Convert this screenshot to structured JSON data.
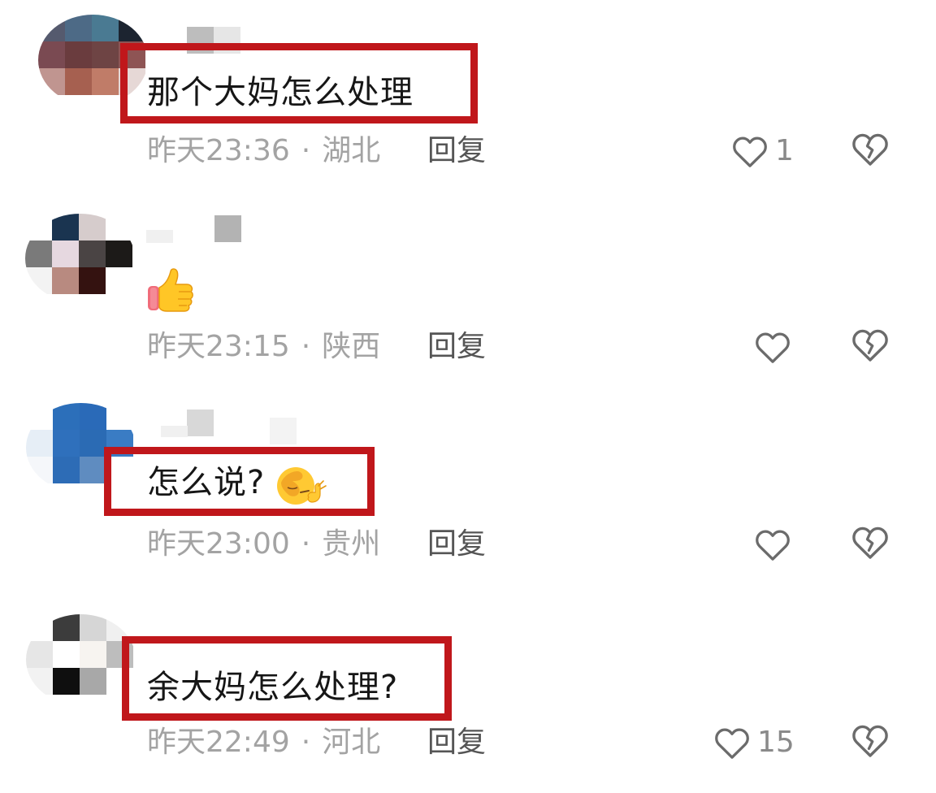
{
  "comments": [
    {
      "text": "那个大妈怎么处理",
      "time": "昨天23:36",
      "separator": "·",
      "location": "湖北",
      "reply_label": "回复",
      "likes": "1",
      "highlighted": true,
      "emoji": ""
    },
    {
      "text": "",
      "time": "昨天23:15",
      "separator": "·",
      "location": "陕西",
      "reply_label": "回复",
      "likes": "",
      "highlighted": false,
      "emoji": "thumbs-up"
    },
    {
      "text": "怎么说?",
      "time": "昨天23:00",
      "separator": "·",
      "location": "贵州",
      "reply_label": "回复",
      "likes": "",
      "highlighted": true,
      "emoji": "facepalm"
    },
    {
      "text": "余大妈怎么处理?",
      "time": "昨天22:49",
      "separator": "·",
      "location": "河北",
      "reply_label": "回复",
      "likes": "15",
      "highlighted": true,
      "emoji": ""
    }
  ],
  "icons": {
    "like": "heart-outline-icon",
    "dislike": "broken-heart-icon",
    "thumbs_up": "thumbs-up-emoji",
    "facepalm": "facepalm-emoji"
  },
  "colors": {
    "highlight": "#c0171b",
    "meta": "#a3a3a3",
    "reply": "#555555",
    "icon": "#6b6b6b"
  }
}
